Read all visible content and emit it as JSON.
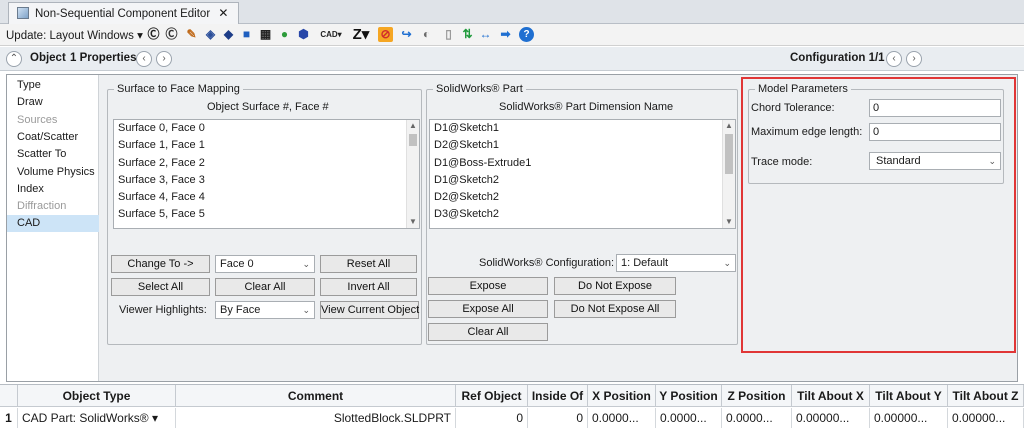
{
  "tab": {
    "title": "Non-Sequential Component Editor",
    "close": "✕"
  },
  "toolbar": {
    "update_label": "Update: Layout Windows",
    "update_arrow": "▾",
    "icons": [
      {
        "name": "refresh-c-icon",
        "glyph": "Ⓒ",
        "color": "#222222"
      },
      {
        "name": "refresh-c-alt-icon",
        "glyph": "Ⓒ",
        "color": "#333333"
      },
      {
        "name": "lens-pencil-icon",
        "glyph": "✎",
        "color": "#c06a1a"
      },
      {
        "name": "shaded-model-icon",
        "glyph": "◈",
        "color": "#2a4e9a"
      },
      {
        "name": "shaded-solid-icon",
        "glyph": "◆",
        "color": "#1d3d88"
      },
      {
        "name": "solid-cube-icon",
        "glyph": "■",
        "color": "#1f5fbf"
      },
      {
        "name": "grid-blocks-icon",
        "glyph": "▦",
        "color": "#222222"
      },
      {
        "name": "green-spheres-icon",
        "glyph": "●",
        "color": "#2d9b3a"
      },
      {
        "name": "blue-hexagon-icon",
        "glyph": "⬢",
        "color": "#2847a8"
      },
      {
        "name": "cad-menu-icon",
        "glyph": "CAD▾",
        "color": "#222222"
      },
      {
        "name": "z-menu-icon",
        "glyph": "Z▾",
        "color": "#111111"
      },
      {
        "name": "no-symbol-icon",
        "glyph": "⊘",
        "color": "#d12c2c"
      },
      {
        "name": "curved-arrow-icon",
        "glyph": "↪",
        "color": "#1f6fd1"
      },
      {
        "name": "toggle-icon",
        "glyph": "◐",
        "color": "#6b6b6b"
      },
      {
        "name": "blank-page-icon",
        "glyph": "▯",
        "color": "#9a9a9a"
      },
      {
        "name": "green-arrows-icon",
        "glyph": "⇅",
        "color": "#1f9a3c"
      },
      {
        "name": "horizontal-arrows-icon",
        "glyph": "↔",
        "color": "#1f6fd1"
      },
      {
        "name": "right-arrow-icon",
        "glyph": "➡",
        "color": "#1f6fd1"
      },
      {
        "name": "help-icon",
        "glyph": "?",
        "color": "#ffffff"
      }
    ]
  },
  "propbar": {
    "collapse_glyph": "⌃",
    "object_label": "Object",
    "properties_label": "1 Properties",
    "prev_glyph": "‹",
    "next_glyph": "›",
    "configuration_label": "Configuration 1/1"
  },
  "nav": {
    "items": [
      {
        "label": "Type",
        "state": "normal"
      },
      {
        "label": "Draw",
        "state": "normal"
      },
      {
        "label": "Sources",
        "state": "disabled"
      },
      {
        "label": "Coat/Scatter",
        "state": "normal"
      },
      {
        "label": "Scatter To",
        "state": "normal"
      },
      {
        "label": "Volume Physics",
        "state": "normal"
      },
      {
        "label": "Index",
        "state": "normal"
      },
      {
        "label": "Diffraction",
        "state": "disabled"
      },
      {
        "label": "CAD",
        "state": "selected"
      }
    ]
  },
  "surface_mapping": {
    "legend": "Surface to Face Mapping",
    "header": "Object Surface #, Face #",
    "rows": [
      "Surface 0, Face 0",
      "Surface 1, Face 1",
      "Surface 2, Face 2",
      "Surface 3, Face 3",
      "Surface 4, Face 4",
      "Surface 5, Face 5"
    ],
    "change_to_label": "Change To ->",
    "face_value": "Face 0",
    "reset_all_label": "Reset All",
    "select_all_label": "Select All",
    "clear_all_label": "Clear All",
    "invert_all_label": "Invert All",
    "viewer_highlights_label": "Viewer Highlights:",
    "highlight_value": "By Face",
    "view_current_label": "View Current Object"
  },
  "solidworks": {
    "legend": "SolidWorks® Part",
    "header": "SolidWorks® Part Dimension Name",
    "rows": [
      "D1@Sketch1",
      "D2@Sketch1",
      "D1@Boss-Extrude1",
      "D1@Sketch2",
      "D2@Sketch2",
      "D3@Sketch2"
    ],
    "configuration_label": "SolidWorks® Configuration:",
    "configuration_value": "1: Default",
    "expose_label": "Expose",
    "do_not_expose_label": "Do Not Expose",
    "expose_all_label": "Expose All",
    "do_not_expose_all_label": "Do Not Expose All",
    "clear_all_label": "Clear All"
  },
  "model_params": {
    "legend": "Model Parameters",
    "chord_label": "Chord Tolerance:",
    "chord_value": "0",
    "max_edge_label": "Maximum edge length:",
    "max_edge_value": "0",
    "trace_label": "Trace mode:",
    "trace_value": "Standard"
  },
  "dropdown_glyph": "⌄",
  "scroll_up": "▲",
  "scroll_down": "▼",
  "grid": {
    "headers": [
      "Object Type",
      "Comment",
      "Ref Object",
      "Inside Of",
      "X Position",
      "Y Position",
      "Z Position",
      "Tilt About X",
      "Tilt About Y",
      "Tilt About Z"
    ],
    "row": {
      "num": "1",
      "object_type": "CAD Part: SolidWorks® ▾",
      "comment": "SlottedBlock.SLDPRT",
      "ref_object": "0",
      "inside_of": "0",
      "x": "0.0000...",
      "y": "0.0000...",
      "z": "0.0000...",
      "tilt_x": "0.00000...",
      "tilt_y": "0.00000...",
      "tilt_z": "0.00000..."
    }
  },
  "colors": {
    "highlight_box": "#e03636",
    "selected_nav": "#cde4f7",
    "accent_blue": "#1f6fd1"
  }
}
